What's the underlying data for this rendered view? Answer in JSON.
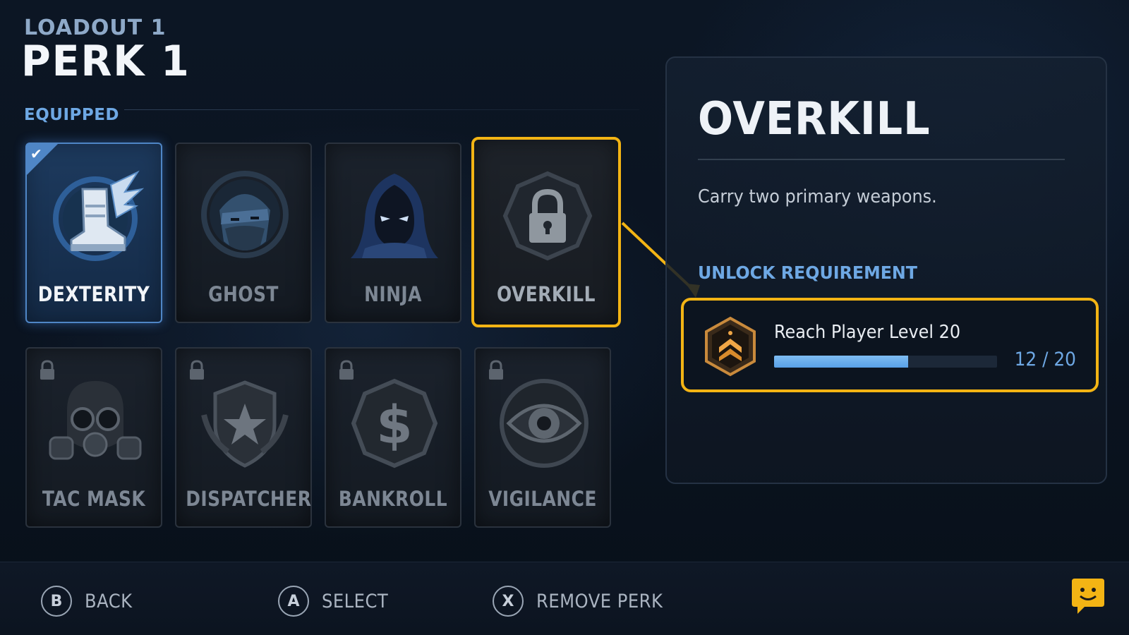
{
  "header": {
    "subtitle": "LOADOUT 1",
    "title": "PERK 1",
    "section_label": "EQUIPPED"
  },
  "perks": [
    {
      "name": "DEXTERITY",
      "icon": "winged-boot-icon",
      "state": "equipped"
    },
    {
      "name": "GHOST",
      "icon": "masked-face-icon",
      "state": "available"
    },
    {
      "name": "NINJA",
      "icon": "hooded-ninja-icon",
      "state": "available"
    },
    {
      "name": "OVERKILL",
      "icon": "padlock-icon",
      "state": "locked-selected"
    },
    {
      "name": "TAC MASK",
      "icon": "gas-mask-icon",
      "state": "locked"
    },
    {
      "name": "DISPATCHER",
      "icon": "star-shield-icon",
      "state": "locked"
    },
    {
      "name": "BANKROLL",
      "icon": "dollar-coin-icon",
      "state": "locked"
    },
    {
      "name": "VIGILANCE",
      "icon": "eye-icon",
      "state": "locked"
    }
  ],
  "detail": {
    "title": "OVERKILL",
    "description": "Carry two primary weapons.",
    "requirement_label": "UNLOCK REQUIREMENT",
    "requirement": {
      "text": "Reach Player Level 20",
      "icon": "rank-chevron-badge-icon",
      "progress_fraction": 0.6,
      "count": "12 / 20"
    }
  },
  "footer": {
    "hints": [
      {
        "button": "B",
        "label": "BACK"
      },
      {
        "button": "A",
        "label": "SELECT"
      },
      {
        "button": "X",
        "label": "REMOVE PERK"
      }
    ]
  },
  "colors": {
    "accent_blue": "#4f86c6",
    "selection_yellow": "#f3b414",
    "label_blue": "#6ea8e4",
    "progress_blue": "#58a0e6"
  }
}
